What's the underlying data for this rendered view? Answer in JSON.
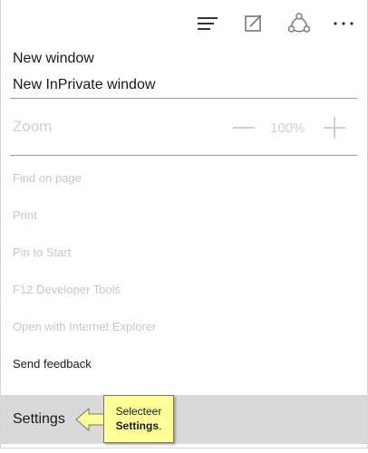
{
  "toolbar": {
    "icons": [
      "hub-icon",
      "web-note-icon",
      "share-icon",
      "more-icon"
    ]
  },
  "menu": {
    "new_window": "New window",
    "new_inprivate_window": "New InPrivate window",
    "zoom_label": "Zoom",
    "zoom_value": "100%",
    "find_on_page": "Find on page",
    "print": "Print",
    "pin_to_start": "Pin to Start",
    "f12_tools": "F12 Developer Tools",
    "open_with_ie": "Open with Internet Explorer",
    "send_feedback": "Send feedback",
    "settings": "Settings"
  },
  "callout": {
    "line1": "Selecteer",
    "line2_bold": "Settings",
    "line2_suffix": "."
  },
  "colors": {
    "disabled_text": "#c8c8c8",
    "highlight_bg": "#d9d9d9",
    "callout_bg": "#ffff99"
  }
}
